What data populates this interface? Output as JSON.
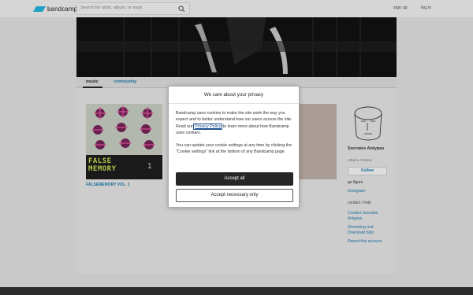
{
  "header": {
    "logo_text": "bandcamp",
    "search_placeholder": "Search for artist, album, or track",
    "signup": "sign up",
    "login": "log in"
  },
  "band": {
    "tabs": {
      "music": "music",
      "community": "community"
    },
    "albums": [
      {
        "title": "FALSEMEMORY VOL. 1",
        "cover_text_line1": "FALSE",
        "cover_text_line2": "MEMORY",
        "cover_number": "1"
      }
    ],
    "artist": {
      "name": "Socrates Antypas",
      "location": "Athens, Greece",
      "follow_label": "Follow",
      "links": [
        "go figure",
        "Instagram"
      ],
      "contact_heading": "contact / help",
      "contact_links": [
        "Contact Socrates Antypas",
        "Streaming and Download help",
        "Report this account"
      ]
    }
  },
  "modal": {
    "title": "We care about your privacy",
    "p1_before": "Bandcamp uses cookies to make the site work the way you expect and to better understand how our users access the site. Read our ",
    "p1_link": "Privacy Policy",
    "p1_after": " to learn more about how Bandcamp uses cookies.",
    "p2": "You can update your cookie settings at any time by clicking the \"Cookie settings\" link at the bottom of any Bandcamp page.",
    "accept_all": "Accept all",
    "accept_necessary": "Accept necessary only"
  },
  "colors": {
    "accent": "#1da0c3",
    "link": "#1b6e9b",
    "accept_bg": "#262626",
    "page_bg": "#c9c9c9"
  }
}
